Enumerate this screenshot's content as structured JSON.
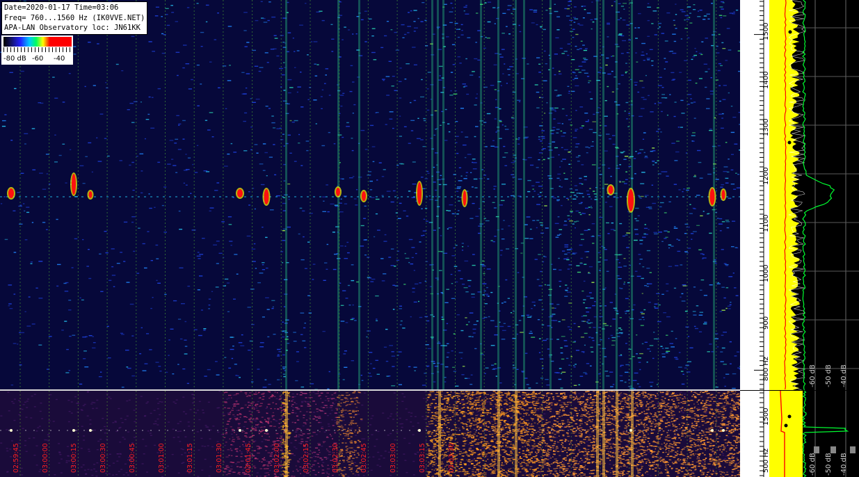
{
  "header": {
    "line1": "Date=2020-01-17 Time=03:06",
    "line2": "Freq= 760...1560 Hz (IK0VVE.NET)",
    "line3": "APA-LAN Observatory loc: JN61KK"
  },
  "legend": {
    "min_label": "-80 dB",
    "mid_label": "-60",
    "max_label": "-40"
  },
  "time_axis": {
    "labels": [
      "02:59:45",
      "03:00:00",
      "03:00:15",
      "03:00:30",
      "03:00:45",
      "03:01:00",
      "03:01:15",
      "03:01:30",
      "03:01:45",
      "03:02:00",
      "03:02:15",
      "03:02:30",
      "03:02:45",
      "03:03:00",
      "03:03:15",
      "03:03:30"
    ]
  },
  "freq_axis_top": {
    "labels": [
      "1500",
      "1400",
      "1300",
      "1200",
      "1100",
      "1000",
      "900",
      "800 Hz"
    ]
  },
  "freq_axis_low": {
    "labels": [
      "1500",
      "500 Hz"
    ]
  },
  "spectrum_top": {
    "db_labels": [
      "-60 dB",
      "-50 dB",
      "-40 dB"
    ]
  },
  "spectrum_low": {
    "db_labels": [
      "-60 dB",
      "-50 dB",
      "-40 dB"
    ]
  },
  "colors": {
    "background": "#06083a",
    "signal_peak": "#ff0000",
    "spectrum_fill": "#ffff00",
    "spectrum_trace": "#00ff30",
    "time_label": "#ff2020"
  }
}
